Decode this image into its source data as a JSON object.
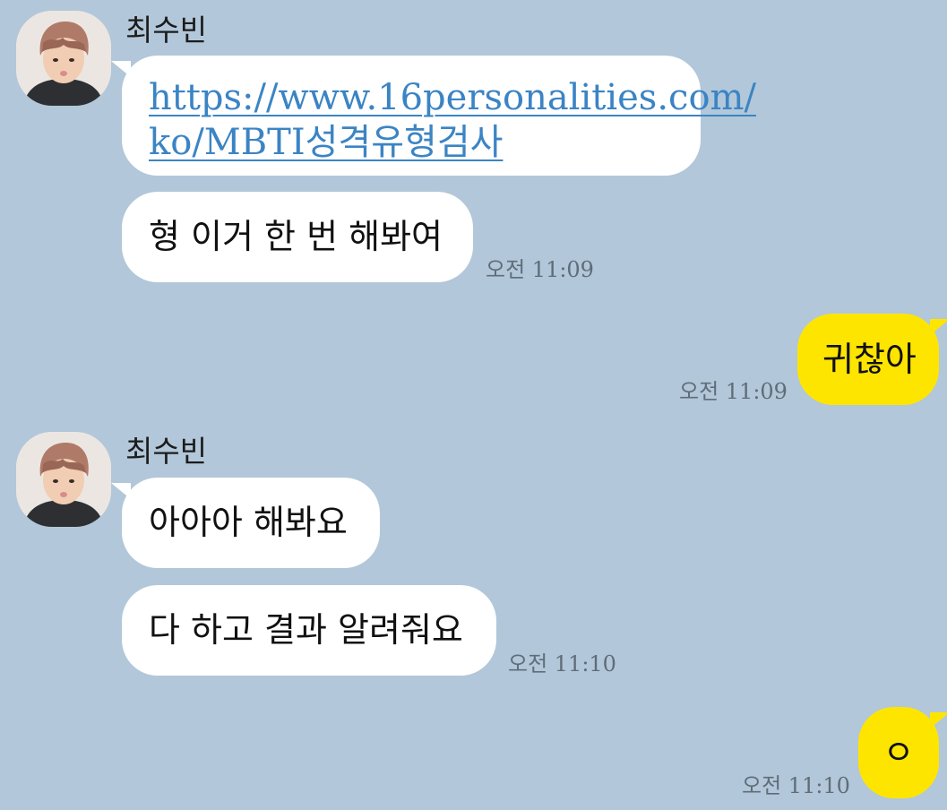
{
  "conversation": {
    "messages": [
      {
        "sender": "최수빈",
        "link_line1": "https://www.16personalities.com/",
        "link_line2": "ko/MBTI성격유형검사"
      },
      {
        "text": "형 이거 한 번 해봐여",
        "time": "오전 11:09"
      },
      {
        "text": "귀찮아",
        "time": "오전 11:09"
      },
      {
        "sender": "최수빈",
        "text": "아아아 해봐요"
      },
      {
        "text": "다 하고 결과 알려줘요",
        "time": "오전 11:10"
      },
      {
        "text": "ㅇ",
        "time": "오전 11:10"
      }
    ]
  },
  "colors": {
    "background": "#b2c7d9",
    "incoming_bubble": "#ffffff",
    "outgoing_bubble": "#fee500",
    "link": "#3b84c4",
    "timestamp": "#5f6d79"
  },
  "icons": {
    "avatar": "profile-photo"
  }
}
